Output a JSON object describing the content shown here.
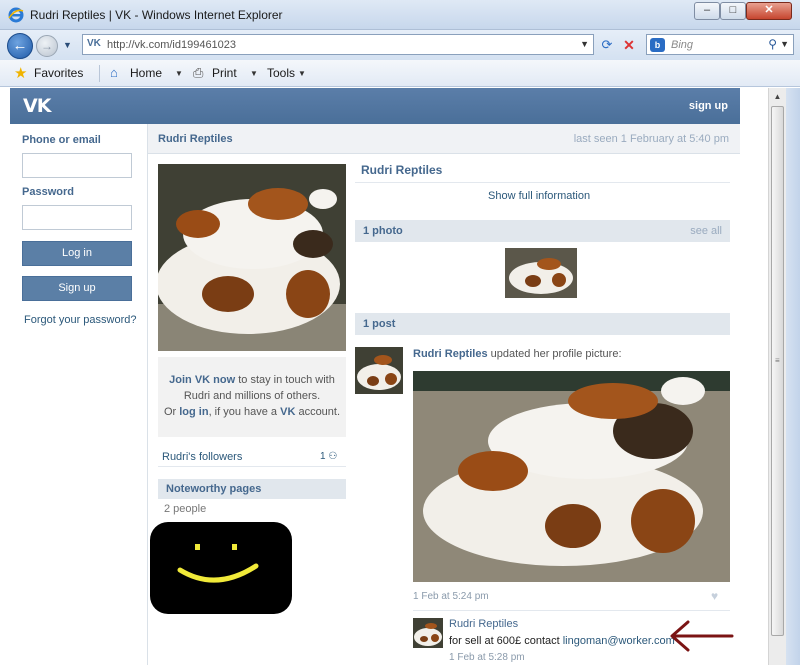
{
  "browser": {
    "window_title": "Rudri Reptiles | VK - Windows Internet Explorer",
    "url": "http://vk.com/id199461023",
    "search_placeholder": "Bing",
    "search_engine_logo": "b",
    "favorites": "Favorites",
    "home": "Home",
    "print": "Print",
    "tools": "Tools"
  },
  "vk": {
    "logo": "VK",
    "sign_up_link": "sign up"
  },
  "login": {
    "phone_label": "Phone or email",
    "password_label": "Password",
    "login_button": "Log in",
    "signup_button": "Sign up",
    "forgot": "Forgot your password?"
  },
  "profile": {
    "name": "Rudri Reptiles",
    "last_seen": "last seen 1 February at 5:40 pm",
    "show_full_info": "Show full information",
    "join_text_bold1": "Join VK now",
    "join_text_1": " to stay in touch with",
    "join_text_2": "Rudri and millions of others.",
    "join_text_3a": "Or ",
    "join_text_bold2": "log in",
    "join_text_3b": ", if you have a ",
    "join_text_bold3": "VK",
    "join_text_3c": " account.",
    "followers_label": "Rudri's followers",
    "followers_count": "1",
    "noteworthy_title": "Noteworthy pages",
    "noteworthy_count": "2 people"
  },
  "photos": {
    "title": "1 photo",
    "see_all": "see all"
  },
  "wall": {
    "title": "1 post",
    "post_author": "Rudri Reptiles",
    "post_action": " updated her profile picture:",
    "post_date": "1 Feb at 5:24 pm",
    "comment_author": "Rudri Reptiles",
    "comment_text": "for sell at 600£ contact ",
    "comment_link": "lingoman@worker.com",
    "comment_date": "1 Feb at 5:28 pm"
  },
  "icons": [
    "ie-logo-icon",
    "back-icon",
    "forward-icon",
    "refresh-icon",
    "stop-icon",
    "search-icon",
    "star-icon",
    "home-icon",
    "print-icon",
    "heart-icon",
    "people-icon"
  ]
}
